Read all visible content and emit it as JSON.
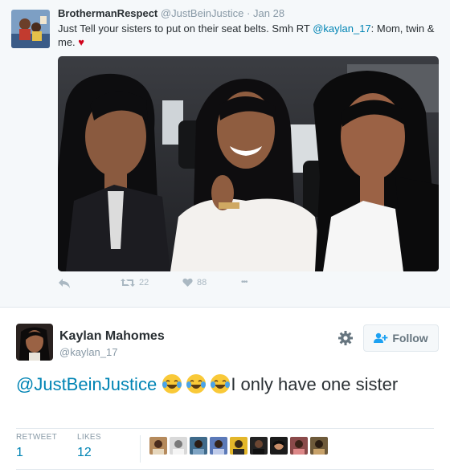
{
  "tweet1": {
    "name": "BrothermanRespect",
    "handle": "@JustBeinJustice",
    "separator": "·",
    "date": "Jan 28",
    "text_pre": "Just Tell your sisters to put on their seat belts. Smh RT ",
    "mention": "@kaylan_17",
    "text_post": ": Mom, twin & me.",
    "heart": "♥",
    "retweets": "22",
    "likes": "88",
    "more": "•••"
  },
  "tweet2": {
    "name": "Kaylan Mahomes",
    "handle": "@kaylan_17",
    "follow_label": "Follow",
    "mention": "@JustBeinJustice",
    "emojis": [
      "face-with-tears-of-joy",
      "face-with-tears-of-joy",
      "face-with-tears-of-joy"
    ],
    "text_post": "I only have one sister",
    "retweet_label": "RETWEET",
    "retweet_count": "1",
    "likes_label": "LIKES",
    "likes_count": "12",
    "liker_count_shown": 9
  },
  "colors": {
    "link": "#0084b4",
    "muted": "#8899a6",
    "action": "#aab8c2",
    "heart": "#d0021b",
    "tweet_bg": "#f5f8fa"
  }
}
